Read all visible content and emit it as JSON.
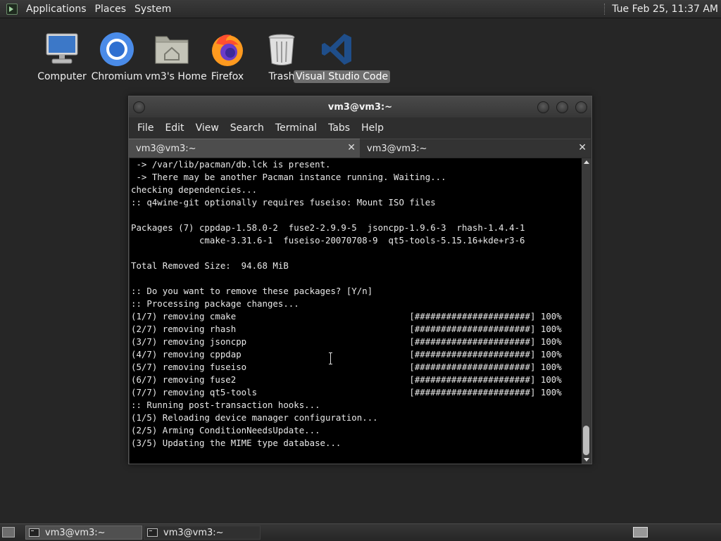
{
  "top_panel": {
    "menus": [
      "Applications",
      "Places",
      "System"
    ],
    "clock": "Tue Feb 25, 11:37 AM"
  },
  "desktop": {
    "icons": [
      {
        "label": "Computer",
        "icon": "computer-icon"
      },
      {
        "label": "Chromium",
        "icon": "chromium-icon"
      },
      {
        "label": "vm3's Home",
        "icon": "home-folder-icon"
      },
      {
        "label": "Firefox",
        "icon": "firefox-icon"
      },
      {
        "label": "Trash",
        "icon": "trash-icon"
      },
      {
        "label": "Visual Studio Code",
        "icon": "vscode-icon",
        "selected": true
      }
    ]
  },
  "window": {
    "title": "vm3@vm3:~",
    "menu": [
      "File",
      "Edit",
      "View",
      "Search",
      "Terminal",
      "Tabs",
      "Help"
    ],
    "tabs": [
      {
        "label": "vm3@vm3:~",
        "active": true
      },
      {
        "label": "vm3@vm3:~",
        "active": false
      }
    ],
    "terminal_lines": [
      " -> /var/lib/pacman/db.lck is present.",
      " -> There may be another Pacman instance running. Waiting...",
      "checking dependencies...",
      ":: q4wine-git optionally requires fuseiso: Mount ISO files",
      "",
      "Packages (7) cppdap-1.58.0-2  fuse2-2.9.9-5  jsoncpp-1.9.6-3  rhash-1.4.4-1",
      "             cmake-3.31.6-1  fuseiso-20070708-9  qt5-tools-5.15.16+kde+r3-6",
      "",
      "Total Removed Size:  94.68 MiB",
      "",
      ":: Do you want to remove these packages? [Y/n]",
      ":: Processing package changes...",
      "(1/7) removing cmake                                 [######################] 100%",
      "(2/7) removing rhash                                 [######################] 100%",
      "(3/7) removing jsoncpp                               [######################] 100%",
      "(4/7) removing cppdap                                [######################] 100%",
      "(5/7) removing fuseiso                               [######################] 100%",
      "(6/7) removing fuse2                                 [######################] 100%",
      "(7/7) removing qt5-tools                             [######################] 100%",
      ":: Running post-transaction hooks...",
      "(1/5) Reloading device manager configuration...",
      "(2/5) Arming ConditionNeedsUpdate...",
      "(3/5) Updating the MIME type database..."
    ]
  },
  "bottom_panel": {
    "tasks": [
      {
        "label": "vm3@vm3:~",
        "active": true
      },
      {
        "label": "vm3@vm3:~",
        "active": false
      }
    ]
  }
}
